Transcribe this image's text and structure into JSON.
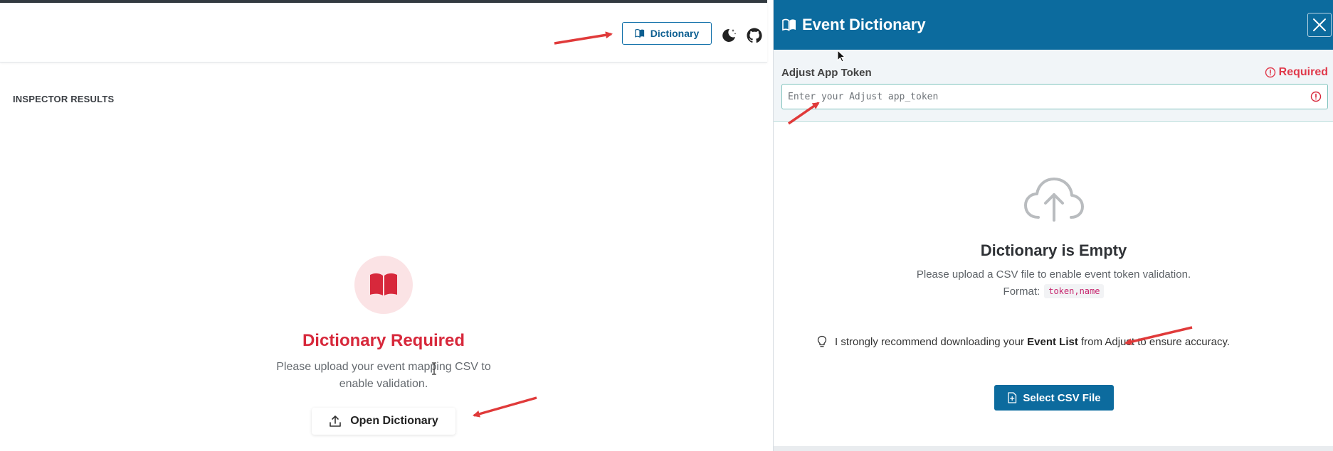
{
  "header": {
    "dictionary_button_label": "Dictionary",
    "theme_icon": "moon-stars-icon",
    "github_icon": "github-icon"
  },
  "results": {
    "title": "INSPECTOR RESULTS",
    "empty_icon": "book-icon",
    "heading": "Dictionary Required",
    "description": "Please upload your event mapping CSV to enable validation.",
    "open_button_label": "Open Dictionary",
    "open_button_icon": "upload-icon"
  },
  "drawer": {
    "title": "Event Dictionary",
    "title_icon": "book-icon",
    "close_icon": "close-icon",
    "token": {
      "label": "Adjust App Token",
      "required_label": "Required",
      "placeholder": "Enter your Adjust app_token",
      "value": ""
    },
    "empty": {
      "icon": "cloud-upload-icon",
      "title": "Dictionary is Empty",
      "description": "Please upload a CSV file to enable event token validation.",
      "format_label": "Format:",
      "format_code": "token,name"
    },
    "tip": {
      "icon": "lightbulb-icon",
      "text_before": "I strongly recommend downloading your",
      "bold": "Event List",
      "text_after": "from Adjust to ensure accuracy."
    },
    "select_button_label": "Select CSV File",
    "select_button_icon": "file-plus-icon"
  },
  "colors": {
    "primary": "#0c6b9e",
    "danger": "#d7283b",
    "annotation_arrow": "#e03a3a"
  }
}
